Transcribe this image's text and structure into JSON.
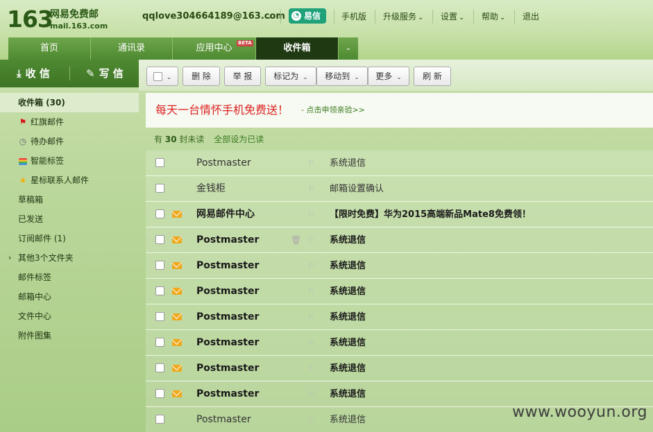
{
  "logo": {
    "number": "163",
    "name": "网易免费邮",
    "domain": "mail.163.com"
  },
  "account": {
    "email": "qqlove304664189@163.com",
    "caret": "⌄"
  },
  "yixin": {
    "label": "易信"
  },
  "top_links": [
    {
      "label": "手机版"
    },
    {
      "label": "升级服务"
    },
    {
      "label": "设置"
    },
    {
      "label": "帮助"
    },
    {
      "label": "退出"
    }
  ],
  "tabs": [
    {
      "label": "首页"
    },
    {
      "label": "通讯录"
    },
    {
      "label": "应用中心",
      "badge": "BETA"
    },
    {
      "label": "收件箱",
      "active": true
    }
  ],
  "sidebar": {
    "receive_label": "收 信",
    "compose_label": "写 信",
    "folders": [
      {
        "label": "收件箱 (30)",
        "active": true
      },
      {
        "label": "红旗邮件",
        "icon": "red-flag-icon"
      },
      {
        "label": "待办邮件",
        "icon": "clock-icon"
      },
      {
        "label": "智能标签",
        "icon": "tag-stack-icon"
      },
      {
        "label": "星标联系人邮件",
        "icon": "star-icon"
      },
      {
        "label": "草稿箱"
      },
      {
        "label": "已发送"
      },
      {
        "label": "订阅邮件 (1)"
      },
      {
        "label": "其他3个文件夹",
        "expandable": true
      },
      {
        "label": "邮件标签"
      },
      {
        "label": "邮箱中心"
      },
      {
        "label": "文件中心"
      },
      {
        "label": "附件图集"
      }
    ]
  },
  "toolbar": {
    "delete": "删 除",
    "report": "举 报",
    "mark_as": "标记为",
    "move_to": "移动到",
    "more": "更多",
    "refresh": "刷 新"
  },
  "ad": {
    "text": "每天一台情怀手机免费送！",
    "link": "- 点击申领亲验>>"
  },
  "unread": {
    "prefix": "有",
    "count": "30",
    "suffix": "封未读",
    "mark_all": "全部设为已读"
  },
  "mails": [
    {
      "sender": "Postmaster",
      "subject": "系统退信",
      "unread": false
    },
    {
      "sender": "金钱柜",
      "subject": "邮箱设置确认",
      "unread": false
    },
    {
      "sender": "网易邮件中心",
      "subject": "【限时免费】华为2015高端新品Mate8免费领！",
      "unread": true
    },
    {
      "sender": "Postmaster",
      "subject": "系统退信",
      "unread": true,
      "hover": true
    },
    {
      "sender": "Postmaster",
      "subject": "系统退信",
      "unread": true
    },
    {
      "sender": "Postmaster",
      "subject": "系统退信",
      "unread": true
    },
    {
      "sender": "Postmaster",
      "subject": "系统退信",
      "unread": true
    },
    {
      "sender": "Postmaster",
      "subject": "系统退信",
      "unread": true
    },
    {
      "sender": "Postmaster",
      "subject": "系统退信",
      "unread": true
    },
    {
      "sender": "Postmaster",
      "subject": "系统退信",
      "unread": true
    },
    {
      "sender": "Postmaster",
      "subject": "系统退信",
      "unread": false
    }
  ],
  "watermark": "www.wooyun.org",
  "colors": {
    "brand_green": "#2b5a17",
    "tab_active": "#1f3a12",
    "ad_red": "#dd2222",
    "envelope": "#f0a81c"
  }
}
